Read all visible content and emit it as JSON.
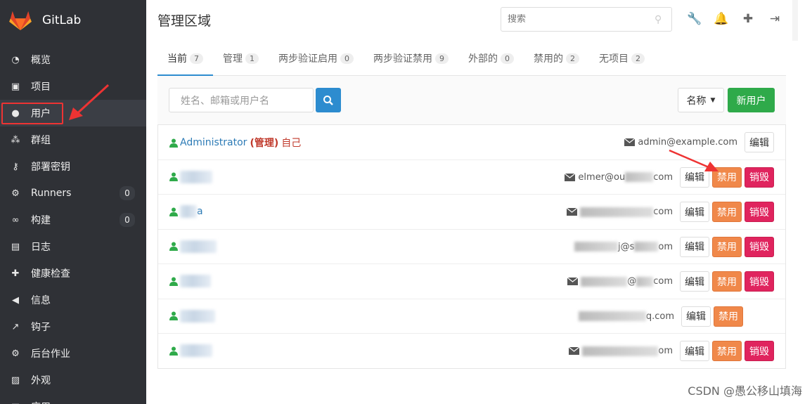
{
  "app": {
    "name": "GitLab"
  },
  "sidebar": {
    "items": [
      {
        "label": "概览",
        "icon": "dashboard-icon"
      },
      {
        "label": "项目",
        "icon": "cube-icon"
      },
      {
        "label": "用户",
        "icon": "user-icon",
        "active": true
      },
      {
        "label": "群组",
        "icon": "users-icon"
      },
      {
        "label": "部署密钥",
        "icon": "key-icon"
      },
      {
        "label": "Runners",
        "icon": "gear-icon",
        "count": "0"
      },
      {
        "label": "构建",
        "icon": "link-icon",
        "count": "0"
      },
      {
        "label": "日志",
        "icon": "file-icon"
      },
      {
        "label": "健康检查",
        "icon": "medkit-icon"
      },
      {
        "label": "信息",
        "icon": "bullhorn-icon"
      },
      {
        "label": "钩子",
        "icon": "external-link-icon"
      },
      {
        "label": "后台作业",
        "icon": "gear-icon"
      },
      {
        "label": "外观",
        "icon": "image-icon"
      },
      {
        "label": "应用",
        "icon": "app-icon"
      }
    ]
  },
  "header": {
    "title": "管理区域",
    "search_placeholder": "搜索"
  },
  "tabs": [
    {
      "label": "当前",
      "count": "7",
      "active": true
    },
    {
      "label": "管理",
      "count": "1"
    },
    {
      "label": "两步验证启用",
      "count": "0"
    },
    {
      "label": "两步验证禁用",
      "count": "9"
    },
    {
      "label": "外部的",
      "count": "0"
    },
    {
      "label": "禁用的",
      "count": "2"
    },
    {
      "label": "无项目",
      "count": "2"
    }
  ],
  "filter": {
    "placeholder": "姓名、邮箱或用户名",
    "sort_label": "名称",
    "new_user_label": "新用户"
  },
  "users": [
    {
      "name": "Administrator",
      "role": "(管理)",
      "self": "自己",
      "email": "admin@example.com"
    },
    {
      "name": "",
      "email": "elmer@ou",
      "email_tail": "com"
    },
    {
      "name": "a",
      "email": "",
      "email_tail": "com"
    },
    {
      "name": "",
      "email": "j@s",
      "email_tail": "om"
    },
    {
      "name": "",
      "email": "@",
      "email_tail": "com"
    },
    {
      "name": "",
      "email": "q.com",
      "email_tail": ""
    },
    {
      "name": "",
      "email": "",
      "email_tail": "om"
    }
  ],
  "buttons": {
    "edit": "编辑",
    "block": "禁用",
    "remove": "销毁"
  },
  "watermark": "CSDN @愚公移山填海",
  "colors": {
    "sidebar_bg": "#2f3136",
    "link": "#2d7bb6",
    "primary": "#2d8ccf",
    "success": "#2faa4a",
    "warning": "#f0884a",
    "danger": "#e0245e",
    "annotation": "#e33"
  }
}
